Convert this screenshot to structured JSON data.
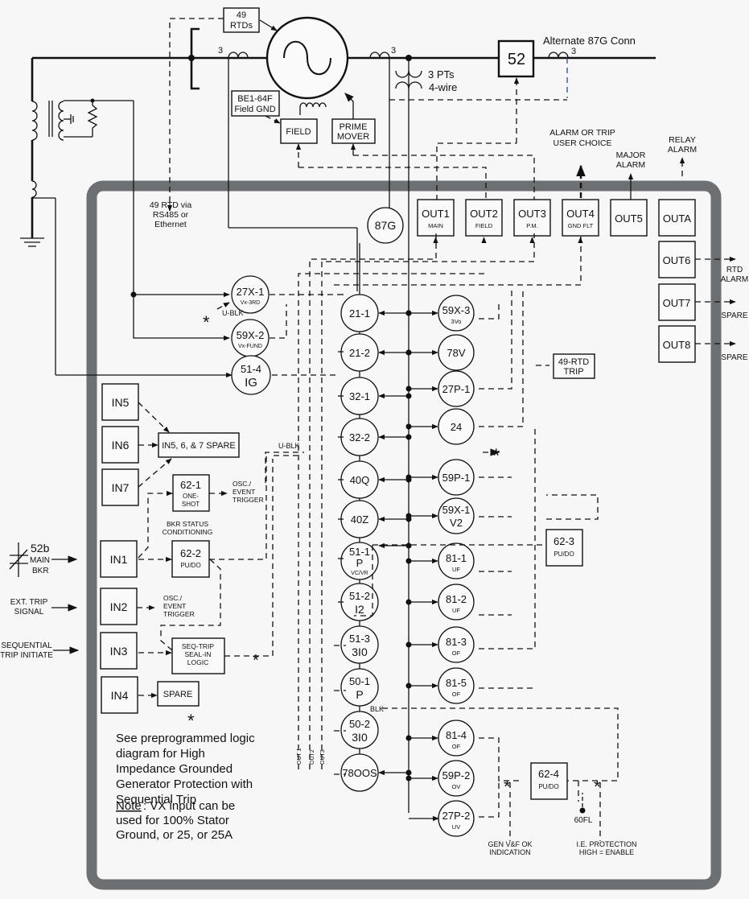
{
  "diagram": {
    "top": {
      "rtd49": [
        "49",
        "RTDs"
      ],
      "ct_count_left": "3",
      "ct_count_mid": "3",
      "ct_count_right": "3",
      "pts": [
        "3 PTs",
        "4-wire"
      ],
      "breaker": "52",
      "alt87g": "Alternate 87G Conn",
      "be164f": [
        "BE1-64F",
        "Field GND"
      ],
      "field": "FIELD",
      "prime_mover": [
        "PRIME",
        "MOVER"
      ],
      "alarm_or_trip": [
        "ALARM OR TRIP",
        "USER CHOICE"
      ],
      "major_alarm": [
        "MAJOR",
        "ALARM"
      ],
      "relay_alarm": [
        "RELAY",
        "ALARM"
      ],
      "rtd_via": [
        "49 RTD via",
        "RS485 or",
        "Ethernet"
      ]
    },
    "outputs": [
      {
        "id": "out1",
        "label": "OUT1",
        "sub": "MAIN"
      },
      {
        "id": "out2",
        "label": "OUT2",
        "sub": "FIELD"
      },
      {
        "id": "out3",
        "label": "OUT3",
        "sub": "P.M."
      },
      {
        "id": "out4",
        "label": "OUT4",
        "sub": "GND FLT"
      },
      {
        "id": "out5",
        "label": "OUT5",
        "sub": ""
      },
      {
        "id": "outa",
        "label": "OUTA",
        "sub": ""
      }
    ],
    "side_outputs": [
      {
        "label": "OUT6",
        "dest": [
          "RTD",
          "ALARM"
        ]
      },
      {
        "label": "OUT7",
        "dest": [
          "SPARE"
        ]
      },
      {
        "label": "OUT8",
        "dest": [
          "SPARE"
        ]
      }
    ],
    "left_functions": [
      {
        "name": "87G",
        "sub": ""
      },
      {
        "name": "27X-1",
        "sub": "Vx-3RD"
      },
      {
        "name": "59X-2",
        "sub": "Vx-FUND"
      },
      {
        "name": "51-4",
        "sub": "IG"
      }
    ],
    "center_functions": [
      {
        "l1": "21-1",
        "l2": "",
        "l3": ""
      },
      {
        "l1": "21-2",
        "l2": "",
        "l3": ""
      },
      {
        "l1": "32-1",
        "l2": "",
        "l3": ""
      },
      {
        "l1": "32-2",
        "l2": "",
        "l3": ""
      },
      {
        "l1": "40Q",
        "l2": "",
        "l3": ""
      },
      {
        "l1": "40Z",
        "l2": "",
        "l3": ""
      },
      {
        "l1": "51-1",
        "l2": "P",
        "l3": "VC/VR"
      },
      {
        "l1": "51-2",
        "l2": "I2",
        "l3": ""
      },
      {
        "l1": "51-3",
        "l2": "3I0",
        "l3": ""
      },
      {
        "l1": "50-1",
        "l2": "P",
        "l3": ""
      },
      {
        "l1": "50-2",
        "l2": "3I0",
        "l3": ""
      },
      {
        "l1": "78OOS",
        "l2": "",
        "l3": ""
      }
    ],
    "right_functions": [
      {
        "name": "59X-3",
        "sub": "3Vo",
        "big": false
      },
      {
        "name": "78V",
        "sub": "",
        "big": false
      },
      {
        "name": "27P-1",
        "sub": "",
        "big": false
      },
      {
        "name": "24",
        "sub": "",
        "big": false
      },
      {
        "name": "59P-1",
        "sub": "",
        "big": false
      },
      {
        "name": "59X-1",
        "sub": "V2",
        "big": true
      },
      {
        "name": "81-1",
        "sub": "UF",
        "big": false
      },
      {
        "name": "81-2",
        "sub": "UF",
        "big": false
      },
      {
        "name": "81-3",
        "sub": "OF",
        "big": false
      },
      {
        "name": "81-5",
        "sub": "OF",
        "big": false
      },
      {
        "name": "81-4",
        "sub": "OF",
        "big": false
      },
      {
        "name": "59P-2",
        "sub": "OV",
        "big": false
      },
      {
        "name": "27P-2",
        "sub": "UV",
        "big": false
      }
    ],
    "inputs": [
      {
        "label": "IN5"
      },
      {
        "label": "IN6"
      },
      {
        "label": "IN7"
      },
      {
        "label": "IN1"
      },
      {
        "label": "IN2"
      },
      {
        "label": "IN3"
      },
      {
        "label": "IN4"
      }
    ],
    "logic_blocks": {
      "spare567": "IN5, 6, & 7 SPARE",
      "b621": [
        "62-1",
        "ONE-",
        "SHOT"
      ],
      "osc1": [
        "OSC./",
        "EVENT",
        "TRIGGER"
      ],
      "bkr_status": [
        "BKR STATUS",
        "CONDITIONING"
      ],
      "b622": [
        "62-2",
        "PU/DO"
      ],
      "osc2": [
        "OSC./",
        "EVENT",
        "TRIGGER"
      ],
      "seqtrip": [
        "SEQ-TRIP",
        "SEAL-IN",
        "LOGIC"
      ],
      "spare": "SPARE",
      "rtd49trip": [
        "49-RTD",
        "TRIP"
      ],
      "b623": [
        "62-3",
        "PU/DO"
      ],
      "b624": [
        "62-4",
        "PU/DO"
      ],
      "fl60": "60FL",
      "gen_vf": [
        "GEN V&F OK",
        "INDICATION"
      ],
      "ie_prot": [
        "I.E. PROTECTION",
        "HIGH = ENABLE"
      ],
      "ublk1": "U-BLK",
      "ublk2": "U-BLK",
      "blk": "BLK",
      "out_tags": [
        "OUT 1",
        "OUT2",
        "OUT3"
      ]
    },
    "external_inputs": {
      "main_bkr": [
        "52b",
        "MAIN",
        "BKR"
      ],
      "ext_trip": [
        "EXT. TRIP",
        "SIGNAL"
      ],
      "seq_trip": [
        "SEQUENTIAL",
        "TRIP INITIATE"
      ]
    },
    "notes": {
      "asterisk": "*",
      "see": [
        "See preprogrammed logic",
        "diagram for High",
        "Impedance Grounded",
        "Generator Protection with",
        "Sequential Trip"
      ],
      "note_label": "Note",
      "note": [
        ": VX input can be",
        "used for 100% Stator",
        "Ground, or 25, or 25A"
      ]
    }
  }
}
